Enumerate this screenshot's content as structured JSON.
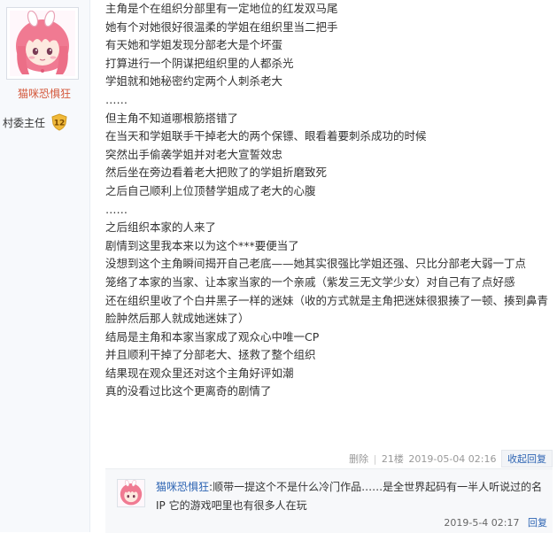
{
  "author": {
    "username": "猫咪恐惧狂",
    "rank": "村委主任",
    "level": "12"
  },
  "post": {
    "lines": [
      "主角是个在组织分部里有一定地位的红发双马尾",
      "她有个对她很好很温柔的学姐在组织里当二把手",
      "有天她和学姐发现分部老大是个坏蛋",
      "打算进行一个阴谋把组织里的人都杀光",
      "学姐就和她秘密约定两个人刺杀老大",
      "……",
      "但主角不知道哪根筋搭错了",
      "在当天和学姐联手干掉老大的两个保镖、眼看着要刺杀成功的时候",
      "突然出手偷袭学姐并对老大宣誓效忠",
      "然后坐在旁边看着老大把败了的学姐折磨致死",
      "之后自己顺利上位顶替学姐成了老大的心腹",
      "……",
      "之后组织本家的人来了",
      "剧情到这里我本来以为这个***要便当了",
      "没想到这个主角瞬间揭开自己老底——她其实很强比学姐还强、只比分部老大弱一丁点",
      "笼络了本家的当家、让本家当家的一个亲戚（紫发三无文学少女）对自己有了点好感",
      "还在组织里收了个白井黑子一样的迷妹（收的方式就是主角把迷妹很狠揍了一顿、揍到鼻青脸肿然后那人就成她迷妹了）",
      "结局是主角和本家当家成了观众心中唯一CP",
      "并且顺利干掉了分部老大、拯救了整个组织",
      "结果现在观众里还对这个主角好评如潮",
      "真的没看过比这个更离奇的剧情了"
    ]
  },
  "meta": {
    "delete": "删除",
    "floor": "21楼",
    "datetime": "2019-05-04 02:16",
    "collapse_reply": "收起回复"
  },
  "reply": {
    "username": "猫咪恐惧狂",
    "colon": ":",
    "text": "顺带一提这个不是什么冷门作品……是全世界起码有一半人听说过的名IP 它的游戏吧里也有很多人在玩",
    "datetime": "2019-5-4 02:17",
    "reply_label": "回复"
  },
  "colors": {
    "username": "#d4593c",
    "link": "#2d64b3",
    "badge": "#f0b93a"
  },
  "icons": {
    "avatar": "pink-haired-anime-girl-avatar",
    "level_badge": "shield-level-icon"
  }
}
